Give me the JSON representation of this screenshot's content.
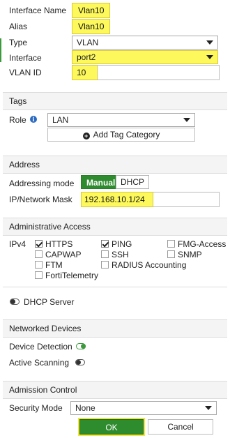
{
  "general": {
    "interface_name_label": "Interface Name",
    "interface_name_value": "Vlan10",
    "alias_label": "Alias",
    "alias_value": "Vlan10",
    "type_label": "Type",
    "type_value": "VLAN",
    "interface_label": "Interface",
    "interface_value": "port2",
    "vlan_id_label": "VLAN ID",
    "vlan_id_value": "10"
  },
  "tags": {
    "header": "Tags",
    "role_label": "Role",
    "role_value": "LAN",
    "add_tag_label": "Add Tag Category"
  },
  "address": {
    "header": "Address",
    "mode_label": "Addressing mode",
    "mode_manual": "Manual",
    "mode_dhcp": "DHCP",
    "ip_label": "IP/Network Mask",
    "ip_value": "192.168.10.1/24"
  },
  "admin_access": {
    "header": "Administrative Access",
    "ipv4_label": "IPv4",
    "options": {
      "https": "HTTPS",
      "ping": "PING",
      "fmg_access": "FMG-Access",
      "capwap": "CAPWAP",
      "ssh": "SSH",
      "snmp": "SNMP",
      "ftm": "FTM",
      "radius": "RADIUS Accounting",
      "fortitelemetry": "FortiTelemetry"
    }
  },
  "dhcp": {
    "label": "DHCP Server"
  },
  "devices": {
    "header": "Networked Devices",
    "device_detection_label": "Device Detection",
    "active_scanning_label": "Active Scanning"
  },
  "admission": {
    "header": "Admission Control",
    "security_mode_label": "Security Mode",
    "security_mode_value": "None"
  },
  "footer": {
    "ok_label": "OK",
    "cancel_label": "Cancel"
  },
  "colors": {
    "highlight": "#fdf95c",
    "accent_green": "#2e8b2e"
  }
}
